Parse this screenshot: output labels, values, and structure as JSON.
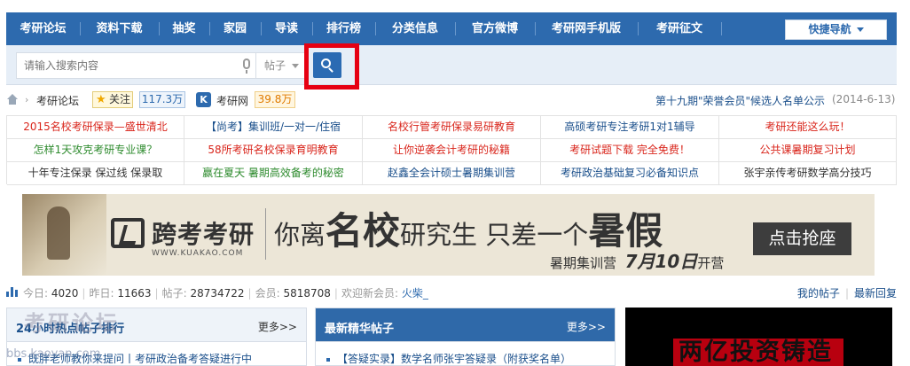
{
  "nav": {
    "items": [
      "考研论坛",
      "资料下载",
      "抽奖",
      "家园",
      "导读",
      "排行榜",
      "分类信息",
      "官方微博",
      "考研网手机版",
      "考研征文"
    ],
    "quick_nav": "快捷导航"
  },
  "search": {
    "placeholder": "请输入搜索内容",
    "type": "帖子"
  },
  "breadcrumb": {
    "forum": "考研论坛",
    "follow": "关注",
    "follow_count": "117.3万",
    "site_icon": "K",
    "site_name": "考研网",
    "site_count": "39.8万",
    "notice": "第十九期\"荣誉会员\"候选人名单公示",
    "notice_date": "(2014-6-13)"
  },
  "ads": [
    [
      {
        "text": "2015名校考研保录—盛世清北",
        "color": "#d9261c"
      },
      {
        "text": "【尚考】集训班/一对一/住宿",
        "color": "#1a4f8b"
      },
      {
        "text": "名校行管考研保录易研教育",
        "color": "#d9261c"
      },
      {
        "text": "高硕考研专注考研1对1辅导",
        "color": "#1a4f8b"
      },
      {
        "text": "考研还能这么玩！",
        "color": "#d9261c"
      }
    ],
    [
      {
        "text": "怎样1天攻克考研专业课？",
        "color": "#2e8b2e"
      },
      {
        "text": "58所考研名校保录育明教育",
        "color": "#d9261c"
      },
      {
        "text": "让你逆袭会计考研的秘籍",
        "color": "#d9261c"
      },
      {
        "text": "考研试题下载 完全免费！",
        "color": "#d9261c"
      },
      {
        "text": "公共课暑期复习计划",
        "color": "#d9261c"
      }
    ],
    [
      {
        "text": "十年专注保录 保过线 保录取",
        "color": "#333333"
      },
      {
        "text": "赢在夏天 暑期高效备考的秘密",
        "color": "#2e8b2e"
      },
      {
        "text": "赵鑫全会计硕士暑期集训营",
        "color": "#1a4f8b"
      },
      {
        "text": "考研政治基础复习必备知识点",
        "color": "#1a4f8b"
      },
      {
        "text": "张宇亲传考研数学高分技巧",
        "color": "#333333"
      }
    ]
  ],
  "banner": {
    "logo": "跨考考研",
    "url": "WWW.KUAKAO.COM",
    "slogan_a": "你离",
    "slogan_b": "名校",
    "slogan_c": "研究生 只差一个",
    "slogan_d": "暑假",
    "sub_a": "暑期集训营",
    "sub_b": "7月10日",
    "sub_c": "开营",
    "cta": "点击抢座"
  },
  "stats": {
    "today_label": "今日:",
    "today": "4020",
    "yesterday_label": "昨日:",
    "yesterday": "11663",
    "posts_label": "帖子:",
    "posts": "28734722",
    "members_label": "会员:",
    "members": "5818708",
    "welcome_label": "欢迎新会员:",
    "newest": "火柴_",
    "my_posts": "我的帖子",
    "latest_reply": "最新回复"
  },
  "panels": {
    "hot_title": "24小时热点帖子排行",
    "hot_more": "更多>>",
    "hot_first": "既胖老师教你来提问丨考研政治备考答疑进行中",
    "best_title": "最新精华帖子",
    "best_more": "更多>>",
    "best_first": "【答疑实录】数学名师张宇答疑录（附获奖名单）",
    "watermark": "考研论坛",
    "watermark2": "bbs.kaoyan.com",
    "ad_text": "两亿投资铸造"
  },
  "colors": {
    "nav_bg": "#2d6aae",
    "search_bg": "#e6eef7",
    "highlight": "#e60012"
  }
}
